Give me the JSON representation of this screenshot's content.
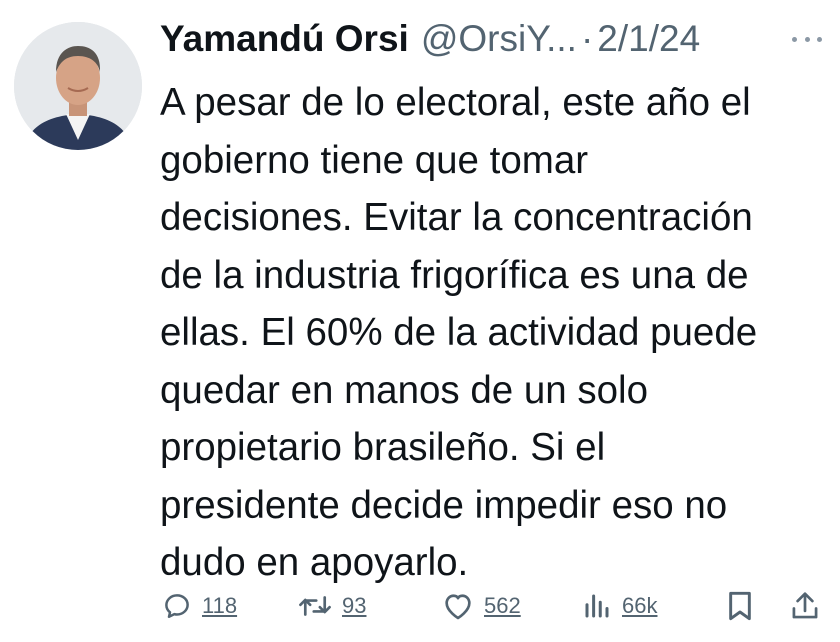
{
  "tweet": {
    "author_name": "Yamandú Orsi",
    "handle": "@OrsiY...",
    "separator": "·",
    "date": "2/1/24",
    "text_lines": [
      "A pesar de lo electoral, este año el",
      "gobierno tiene que tomar",
      "decisiones. Evitar la concentración",
      "de la industria frigorífica es una de",
      "ellas. El 60% de la actividad puede",
      "quedar en manos de un solo",
      "propietario brasileño. Si el",
      "presidente decide impedir eso no",
      "dudo en apoyarlo."
    ]
  },
  "actions": {
    "replies": "118",
    "reposts": "93",
    "likes": "562",
    "views": "66k"
  },
  "icons": {
    "more": "more-horizontal-icon",
    "reply": "reply-icon",
    "repost": "repost-icon",
    "like": "heart-icon",
    "views": "views-chart-icon",
    "bookmark": "bookmark-icon",
    "share": "share-icon"
  },
  "colors": {
    "text": "#0f1419",
    "secondary": "#536471"
  }
}
